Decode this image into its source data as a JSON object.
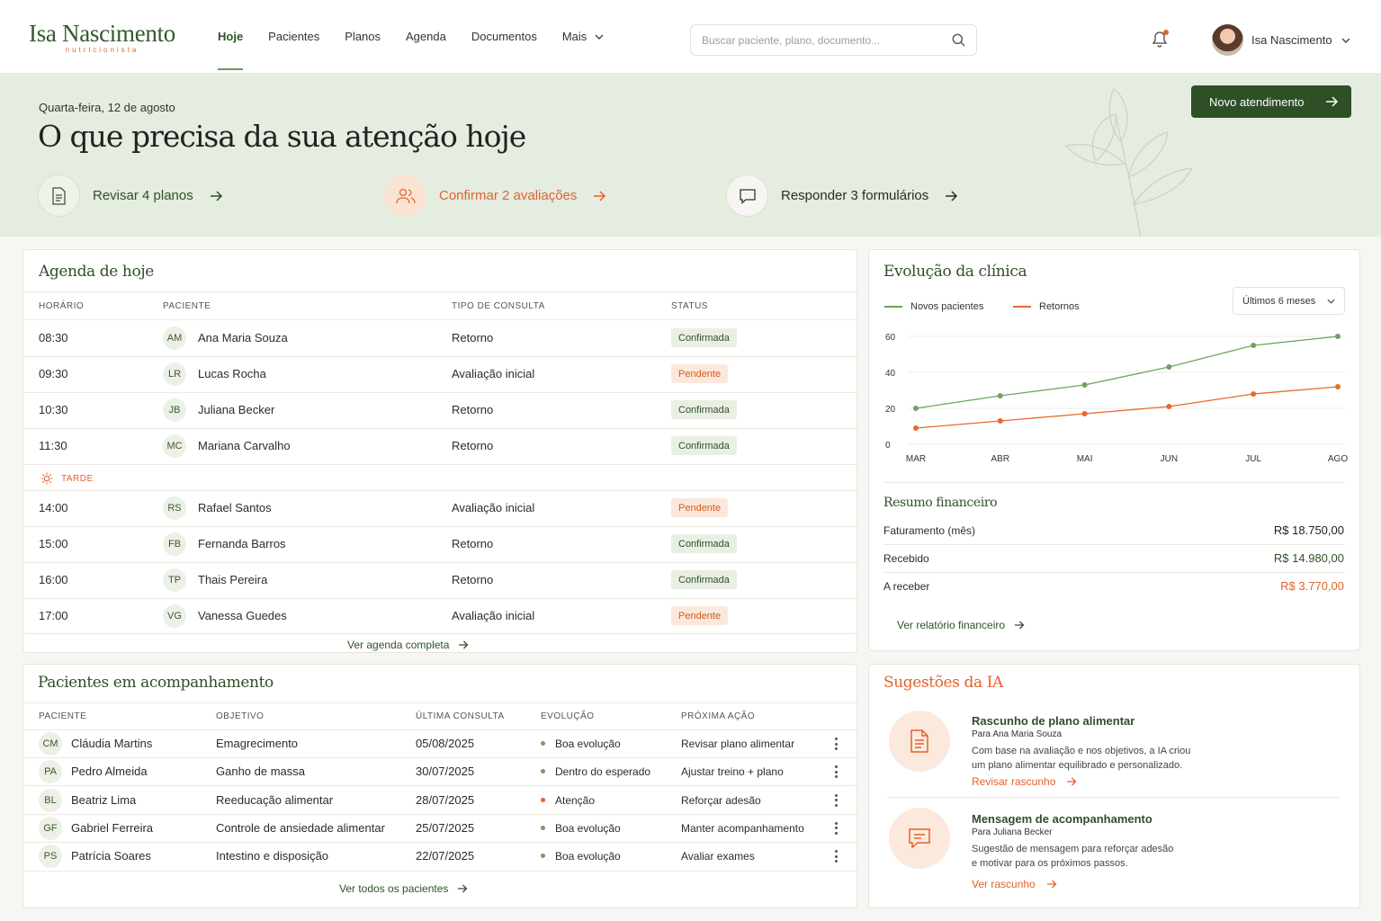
{
  "brand": {
    "name": "Isa Nascimento",
    "subtitle": "nutricionista"
  },
  "nav": [
    {
      "label": "Hoje",
      "active": true
    },
    {
      "label": "Pacientes"
    },
    {
      "label": "Planos"
    },
    {
      "label": "Agenda"
    },
    {
      "label": "Documentos"
    },
    {
      "label": "Mais"
    }
  ],
  "search": {
    "placeholder": "Buscar paciente, plano, documento..."
  },
  "user": {
    "name": "Isa Nascimento"
  },
  "hero": {
    "date": "Quarta-feira, 12 de agosto",
    "title": "O que precisa da sua atenção hoje",
    "cta": "Novo atendimento",
    "actions": [
      {
        "label": "Revisar 4 planos",
        "icon": "document-icon"
      },
      {
        "label": "Confirmar 2 avaliações",
        "icon": "users-icon"
      },
      {
        "label": "Responder 3 formulários",
        "icon": "chat-icon"
      }
    ]
  },
  "agenda": {
    "title": "Agenda de hoje",
    "headers": [
      "HORÁRIO",
      "PACIENTE",
      "TIPO DE CONSULTA",
      "STATUS"
    ],
    "rows_morning": [
      {
        "time": "08:30",
        "initials": "AM",
        "name": "Ana Maria Souza",
        "type": "Retorno",
        "status": "Confirmada"
      },
      {
        "time": "09:30",
        "initials": "LR",
        "name": "Lucas Rocha",
        "type": "Avaliação inicial",
        "status": "Pendente"
      },
      {
        "time": "10:30",
        "initials": "JB",
        "name": "Juliana Becker",
        "type": "Retorno",
        "status": "Confirmada"
      },
      {
        "time": "11:30",
        "initials": "MC",
        "name": "Mariana Carvalho",
        "type": "Retorno",
        "status": "Confirmada"
      }
    ],
    "afternoon_label": "TARDE",
    "rows_afternoon": [
      {
        "time": "14:00",
        "initials": "RS",
        "name": "Rafael Santos",
        "type": "Avaliação inicial",
        "status": "Pendente"
      },
      {
        "time": "15:00",
        "initials": "FB",
        "name": "Fernanda Barros",
        "type": "Retorno",
        "status": "Confirmada"
      },
      {
        "time": "16:00",
        "initials": "TP",
        "name": "Thais Pereira",
        "type": "Retorno",
        "status": "Confirmada"
      },
      {
        "time": "17:00",
        "initials": "VG",
        "name": "Vanessa Guedes",
        "type": "Avaliação inicial",
        "status": "Pendente"
      }
    ],
    "link": "Ver agenda completa"
  },
  "patients": {
    "title": "Pacientes em acompanhamento",
    "headers": [
      "PACIENTE",
      "OBJETIVO",
      "ÚLTIMA CONSULTA",
      "EVOLUÇÃO",
      "PRÓXIMA AÇÃO"
    ],
    "rows": [
      {
        "initials": "CM",
        "name": "Cláudia Martins",
        "goal": "Emagrecimento",
        "last": "05/08/2025",
        "evolution": "Boa evolução",
        "evo_color": "#6ea35e",
        "next": "Revisar plano alimentar"
      },
      {
        "initials": "PA",
        "name": "Pedro Almeida",
        "goal": "Ganho de massa",
        "last": "30/07/2025",
        "evolution": "Dentro do esperado",
        "evo_color": "#6ea35e",
        "next": "Ajustar treino + plano"
      },
      {
        "initials": "BL",
        "name": "Beatriz Lima",
        "goal": "Reeducação alimentar",
        "last": "28/07/2025",
        "evolution": "Atenção",
        "evo_color": "#e3632a",
        "next": "Reforçar adesão"
      },
      {
        "initials": "GF",
        "name": "Gabriel Ferreira",
        "goal": "Controle de ansiedade alimentar",
        "last": "25/07/2025",
        "evolution": "Boa evolução",
        "evo_color": "#6ea35e",
        "next": "Manter acompanhamento"
      },
      {
        "initials": "PS",
        "name": "Patrícia Soares",
        "goal": "Intestino e disposição",
        "last": "22/07/2025",
        "evolution": "Boa evolução",
        "evo_color": "#6ea35e",
        "next": "Avaliar exames"
      }
    ],
    "link": "Ver todos os pacientes"
  },
  "evolution": {
    "title": "Evolução da clínica",
    "period": "Últimos 6 meses"
  },
  "chart_data": {
    "type": "line",
    "categories": [
      "MAR",
      "ABR",
      "MAI",
      "JUN",
      "JUL",
      "AGO"
    ],
    "ylim": [
      0,
      60
    ],
    "yticks": [
      0,
      20,
      40,
      60
    ],
    "grid": true,
    "legend": "top-left",
    "series": [
      {
        "name": "Novos pacientes",
        "color": "#6ea35e",
        "values": [
          20,
          27,
          33,
          43,
          55,
          60
        ]
      },
      {
        "name": "Retornos",
        "color": "#e8692e",
        "values": [
          9,
          13,
          17,
          21,
          28,
          32
        ]
      }
    ]
  },
  "finance": {
    "title": "Resumo financeiro",
    "rows": [
      {
        "label": "Faturamento (mês)",
        "value": "R$ 18.750,00",
        "color": "#222222"
      },
      {
        "label": "Recebido",
        "value": "R$ 14.980,00",
        "color": "#2f5229"
      },
      {
        "label": "A receber",
        "value": "R$ 3.770,00",
        "color": "#e3632a"
      }
    ],
    "link": "Ver relatório financeiro"
  },
  "suggestions": {
    "title": "Sugestões da IA",
    "items": [
      {
        "title": "Rascunho de plano alimentar",
        "for": "Para Ana Maria Souza",
        "desc1": "Com base na avaliação e nos objetivos, a IA criou",
        "desc2": "um plano alimentar equilibrado e personalizado.",
        "link": "Revisar rascunho",
        "icon": "document-icon"
      },
      {
        "title": "Mensagem de acompanhamento",
        "for": "Para Juliana Becker",
        "desc1": "Sugestão de mensagem para reforçar adesão",
        "desc2": "e motivar para os próximos passos.",
        "link": "Ver rascunho",
        "icon": "message-icon"
      }
    ]
  }
}
